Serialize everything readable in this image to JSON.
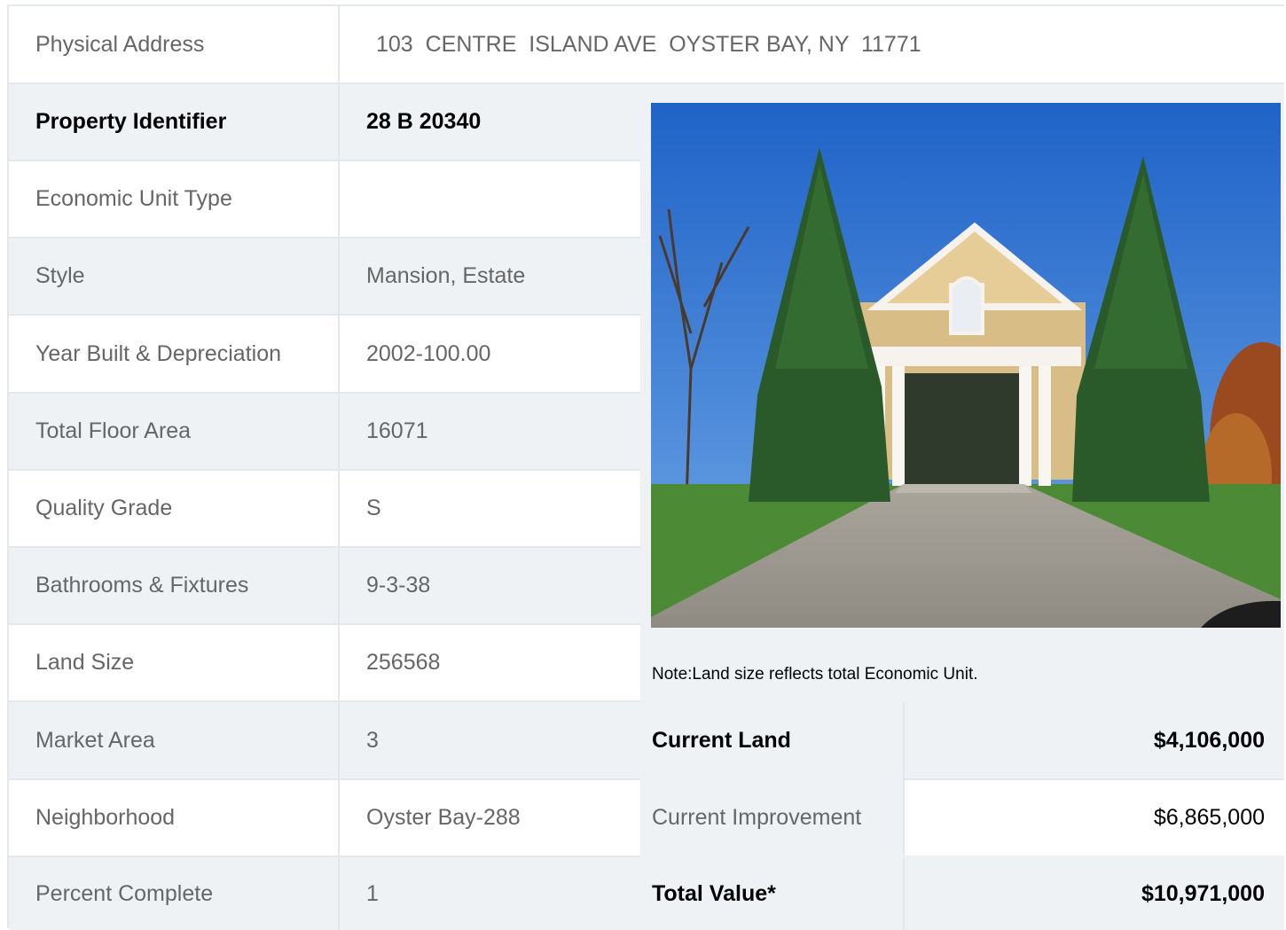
{
  "address": {
    "label": "Physical Address",
    "value": "103  CENTRE  ISLAND AVE  OYSTER BAY, NY  11771"
  },
  "details": [
    {
      "label": "Property Identifier",
      "value": "28  B  20340"
    },
    {
      "label": "Economic Unit Type",
      "value": ""
    },
    {
      "label": "Style",
      "value": "Mansion, Estate"
    },
    {
      "label": "Year Built & Depreciation",
      "value": "2002-100.00"
    },
    {
      "label": "Total Floor Area",
      "value": "16071"
    },
    {
      "label": "Quality Grade",
      "value": "S"
    },
    {
      "label": "Bathrooms & Fixtures",
      "value": "9-3-38"
    },
    {
      "label": "Land Size",
      "value": "256568"
    },
    {
      "label": "Market Area",
      "value": "3"
    },
    {
      "label": "Neighborhood",
      "value": "Oyster Bay-288"
    },
    {
      "label": "Percent Complete",
      "value": "1"
    }
  ],
  "note": "Note:Land size reflects total Economic Unit.",
  "valuation": [
    {
      "label": "Current Land",
      "amount": "$4,106,000"
    },
    {
      "label": "Current Improvement",
      "amount": "$6,865,000"
    },
    {
      "label": "Total Value*",
      "amount": "$10,971,000"
    }
  ],
  "colors": {
    "border": "#e4e8ec",
    "row_alt": "#eef2f5",
    "text_muted": "#666666",
    "text_strong": "#000000"
  },
  "icons": {
    "property_photo": "house-photo"
  }
}
